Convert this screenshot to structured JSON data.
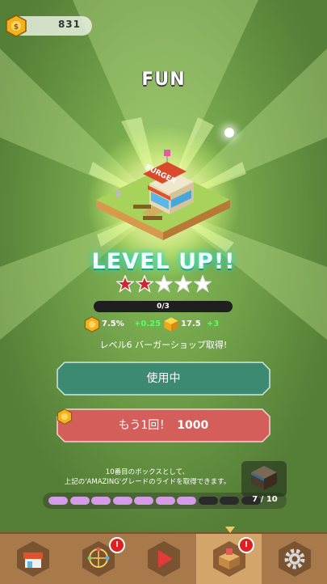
{
  "header": {
    "coins": "831"
  },
  "title": "FUN",
  "level_up": {
    "text": "LEVEL UP!!",
    "stars_filled": 2,
    "stars_total": 5,
    "progress_text": "0/3",
    "progress_fraction": 0.0
  },
  "stats": {
    "rate": "7.5%",
    "rate_bonus": "+0.25",
    "value": "17.5",
    "value_bonus": "+3"
  },
  "description": "レベル6 バーガーショップ取得!",
  "buttons": {
    "in_use": "使用中",
    "again": "もう1回！",
    "again_price": "1000"
  },
  "box": {
    "note_line1": "10番目のボックスとして、",
    "note_line2": "上記の'AMAZING'グレードのライドを取得できます。",
    "count": "7 / 10",
    "filled": 7,
    "total": 10
  },
  "shop_sign": "BURGER",
  "bottom_tabs": [
    {
      "name": "shop",
      "badge": ""
    },
    {
      "name": "wheel",
      "badge": "!"
    },
    {
      "name": "play",
      "badge": ""
    },
    {
      "name": "rides",
      "badge": "!"
    },
    {
      "name": "settings",
      "badge": ""
    }
  ],
  "colors": {
    "accent_teal": "#3d8a72",
    "accent_red": "#d45f5a",
    "progress": "#d49be6",
    "star": "#d3262b"
  }
}
